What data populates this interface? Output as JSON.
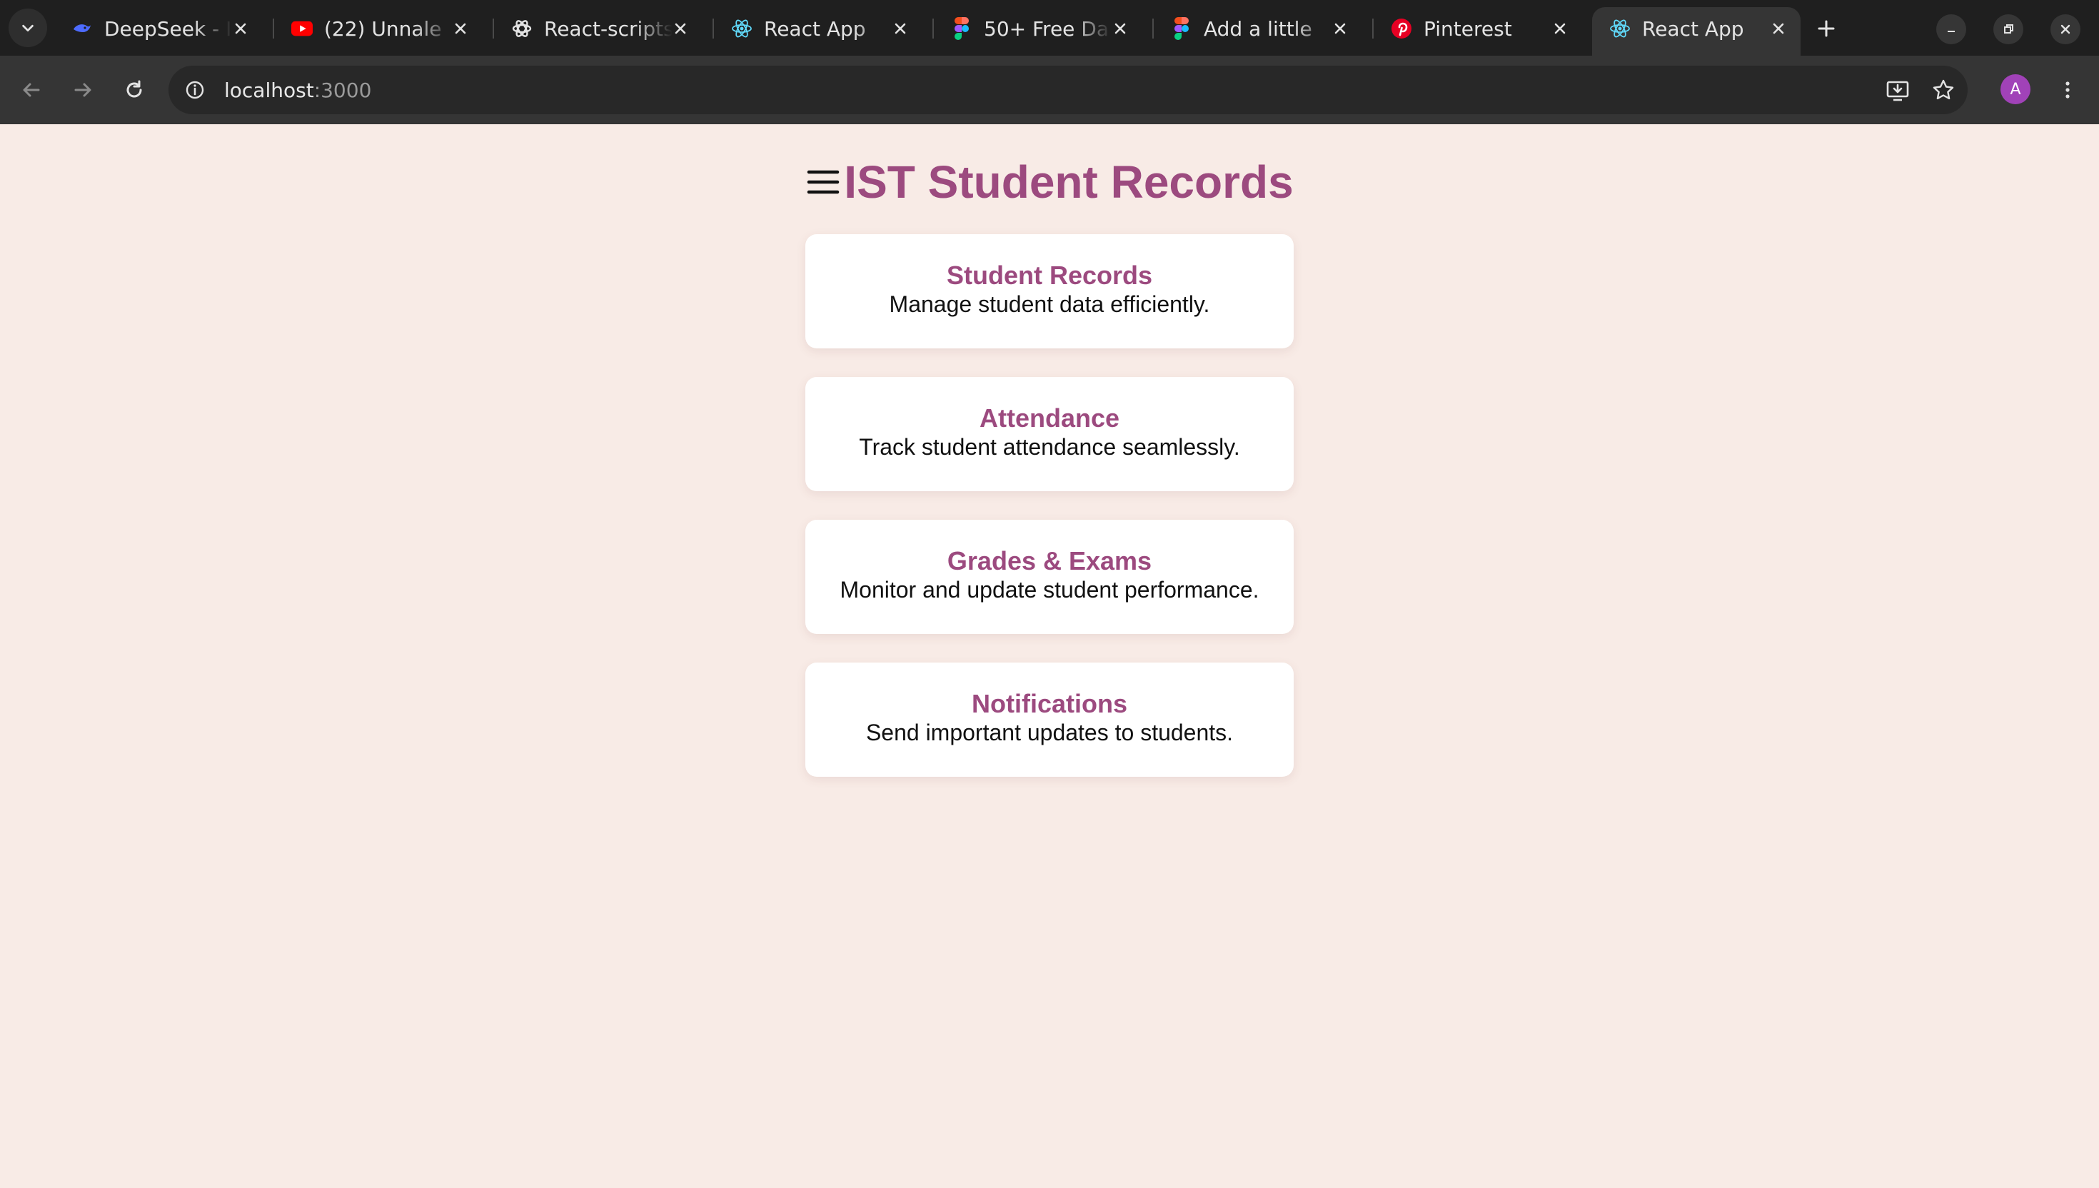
{
  "browser": {
    "tabs": [
      {
        "title": "DeepSeek - I",
        "icon": "deepseek-whale-icon",
        "icon_color": "#4d6bfe"
      },
      {
        "title": "(22) Unnale",
        "icon": "youtube-icon",
        "icon_color": "#ff0000"
      },
      {
        "title": "React-scripts",
        "icon": "openai-icon",
        "icon_color": "#e3e3e3"
      },
      {
        "title": "React App",
        "icon": "react-icon",
        "icon_color": "#61dafb"
      },
      {
        "title": "50+ Free Da",
        "icon": "figma-icon",
        "icon_color": "#f24e1e"
      },
      {
        "title": "Add a little",
        "icon": "figma-icon",
        "icon_color": "#f24e1e"
      },
      {
        "title": "Pinterest",
        "icon": "pinterest-icon",
        "icon_color": "#e60023"
      },
      {
        "title": "React App",
        "icon": "react-icon",
        "icon_color": "#61dafb"
      }
    ],
    "active_tab_index": 7,
    "address": {
      "host": "localhost",
      "port": ":3000"
    },
    "profile_initial": "A",
    "profile_color": "#a142b8"
  },
  "page": {
    "title": "IST Student Records",
    "accent_color": "#9c4a7f",
    "background_color": "#f8ebe6",
    "cards": [
      {
        "title": "Student Records",
        "description": "Manage student data efficiently."
      },
      {
        "title": "Attendance",
        "description": "Track student attendance seamlessly."
      },
      {
        "title": "Grades & Exams",
        "description": "Monitor and update student performance."
      },
      {
        "title": "Notifications",
        "description": "Send important updates to students."
      }
    ]
  }
}
